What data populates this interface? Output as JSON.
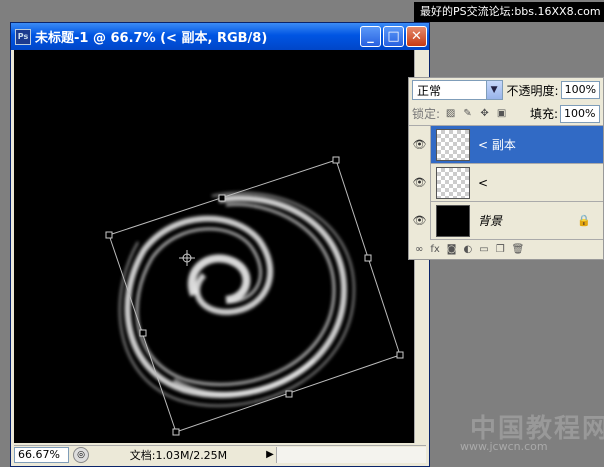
{
  "watermark": {
    "top": "最好的PS交流论坛:bbs.16XX8.com",
    "bottom": "中国教程网",
    "url": "www.jcwcn.com"
  },
  "window": {
    "app_icon": "Ps",
    "title": "未标题-1 @ 66.7% (< 副本, RGB/8)",
    "minimize": "_",
    "maximize": "□",
    "close": "✕"
  },
  "status": {
    "zoom": "66.67%",
    "doc_info": "文档:1.03M/2.25M",
    "arrow": "▶"
  },
  "layers_panel": {
    "blend_mode": "正常",
    "opacity_label": "不透明度:",
    "opacity": "100%",
    "lock_label": "锁定:",
    "fill_label": "填充:",
    "fill": "100%",
    "layers": [
      {
        "name": "< 副本",
        "selected": true
      },
      {
        "name": "<",
        "selected": false
      },
      {
        "name": "背景",
        "selected": false,
        "locked": true
      }
    ],
    "footer_icons": [
      "link-icon",
      "fx-icon",
      "mask-icon",
      "adjustment-icon",
      "group-icon",
      "new-layer-icon",
      "trash-icon"
    ]
  },
  "colors": {
    "selection": "#316ac5",
    "titlebar": "#0055e3"
  }
}
